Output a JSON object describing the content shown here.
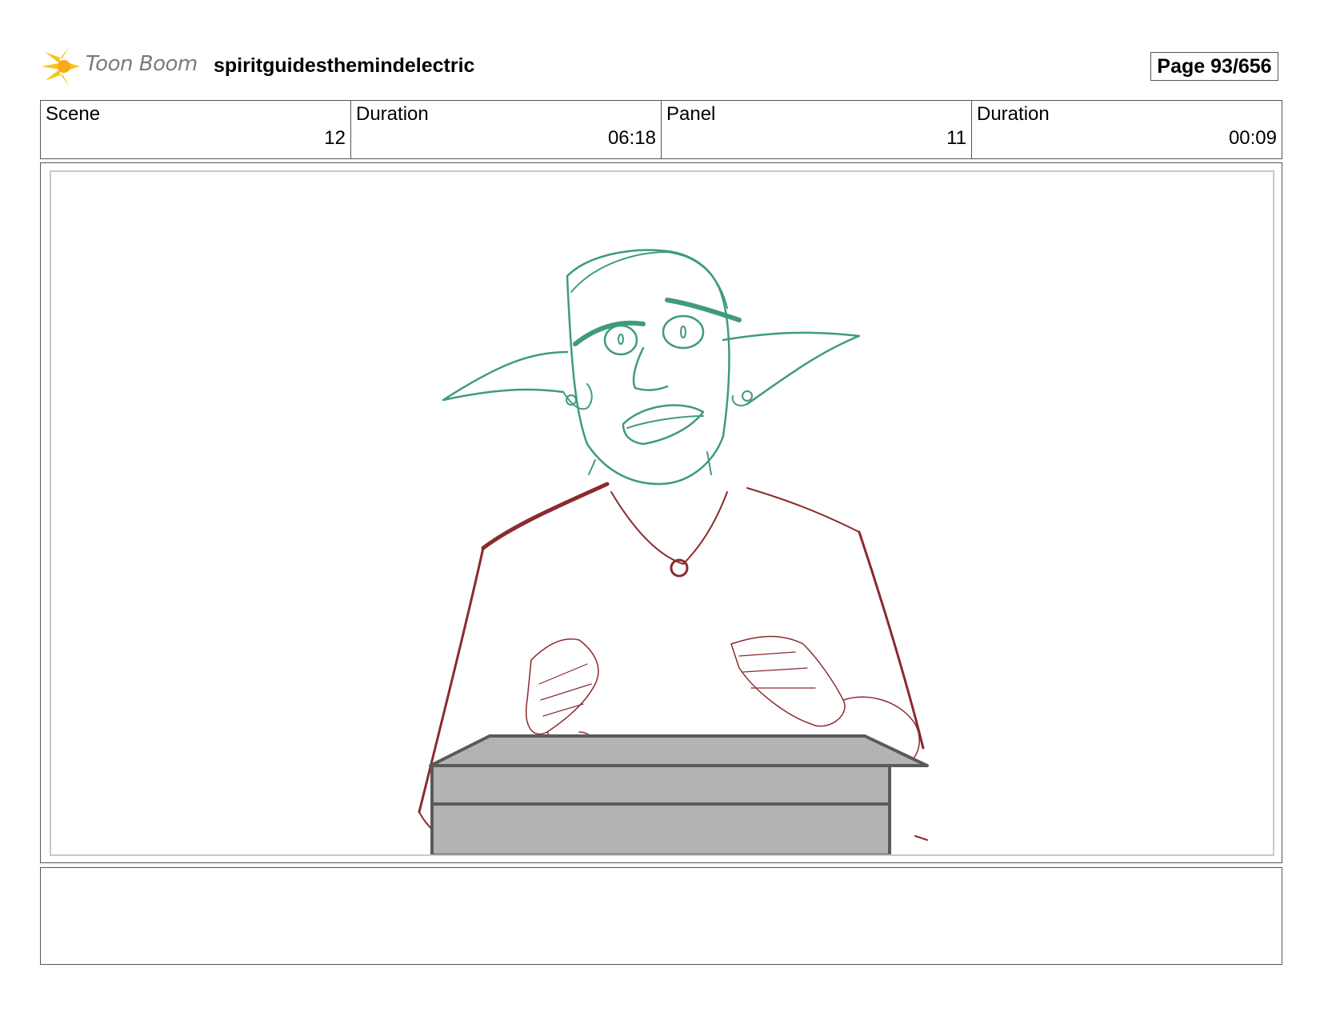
{
  "header": {
    "logo_text": "Toon Boom",
    "project_title": "spiritguidesthemindelectric",
    "page_label": "Page  93/656"
  },
  "info": {
    "scene_label": "Scene",
    "scene_value": "12",
    "scene_duration_label": "Duration",
    "scene_duration_value": "06:18",
    "panel_label": "Panel",
    "panel_value": "11",
    "panel_duration_label": "Duration",
    "panel_duration_value": "00:09"
  },
  "drawing": {
    "description_icon": "storyboard-sketch",
    "character_line_color": "#3f9a7e",
    "body_line_color": "#8b2a2f",
    "box_fill_color": "#b3b3b3",
    "box_line_color": "#5a5a5a"
  },
  "notes": {
    "text": ""
  }
}
